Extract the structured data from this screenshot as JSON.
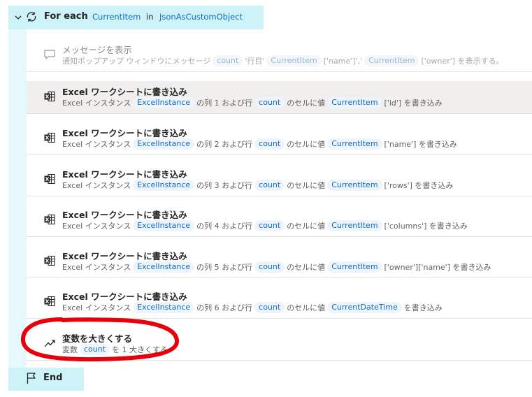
{
  "loop": {
    "label": "For each",
    "variable": "CurrentItem",
    "in_text": "in",
    "list": "JsonAsCustomObject",
    "end_label": "End"
  },
  "actions": [
    {
      "title": "メッセージを表示",
      "icon": "message-icon",
      "disabled": true,
      "desc": [
        {
          "t": "text",
          "v": "通知ポップアップ ウィンドウにメッセージ"
        },
        {
          "t": "var",
          "v": "count"
        },
        {
          "t": "text",
          "v": "'行目'"
        },
        {
          "t": "var",
          "v": "CurrentItem"
        },
        {
          "t": "text",
          "v": "['name']','"
        },
        {
          "t": "var",
          "v": "CurrentItem"
        },
        {
          "t": "text",
          "v": "['owner'] を表示する。"
        }
      ]
    },
    {
      "title": "Excel ワークシートに書き込み",
      "icon": "excel-icon",
      "selected": true,
      "desc": [
        {
          "t": "text",
          "v": "Excel インスタンス"
        },
        {
          "t": "var",
          "v": "ExcelInstance"
        },
        {
          "t": "text",
          "v": "の列 1 および行"
        },
        {
          "t": "var",
          "v": "count"
        },
        {
          "t": "text",
          "v": "のセルに値"
        },
        {
          "t": "var",
          "v": "CurrentItem"
        },
        {
          "t": "text",
          "v": "['id'] を書き込み"
        }
      ]
    },
    {
      "title": "Excel ワークシートに書き込み",
      "icon": "excel-icon",
      "desc": [
        {
          "t": "text",
          "v": "Excel インスタンス"
        },
        {
          "t": "var",
          "v": "ExcelInstance"
        },
        {
          "t": "text",
          "v": "の列 2 および行"
        },
        {
          "t": "var",
          "v": "count"
        },
        {
          "t": "text",
          "v": "のセルに値"
        },
        {
          "t": "var",
          "v": "CurrentItem"
        },
        {
          "t": "text",
          "v": "['name'] を書き込み"
        }
      ]
    },
    {
      "title": "Excel ワークシートに書き込み",
      "icon": "excel-icon",
      "desc": [
        {
          "t": "text",
          "v": "Excel インスタンス"
        },
        {
          "t": "var",
          "v": "ExcelInstance"
        },
        {
          "t": "text",
          "v": "の列 3 および行"
        },
        {
          "t": "var",
          "v": "count"
        },
        {
          "t": "text",
          "v": "のセルに値"
        },
        {
          "t": "var",
          "v": "CurrentItem"
        },
        {
          "t": "text",
          "v": "['rows'] を書き込み"
        }
      ]
    },
    {
      "title": "Excel ワークシートに書き込み",
      "icon": "excel-icon",
      "desc": [
        {
          "t": "text",
          "v": "Excel インスタンス"
        },
        {
          "t": "var",
          "v": "ExcelInstance"
        },
        {
          "t": "text",
          "v": "の列 4 および行"
        },
        {
          "t": "var",
          "v": "count"
        },
        {
          "t": "text",
          "v": "のセルに値"
        },
        {
          "t": "var",
          "v": "CurrentItem"
        },
        {
          "t": "text",
          "v": "['columns'] を書き込み"
        }
      ]
    },
    {
      "title": "Excel ワークシートに書き込み",
      "icon": "excel-icon",
      "desc": [
        {
          "t": "text",
          "v": "Excel インスタンス"
        },
        {
          "t": "var",
          "v": "ExcelInstance"
        },
        {
          "t": "text",
          "v": "の列 5 および行"
        },
        {
          "t": "var",
          "v": "count"
        },
        {
          "t": "text",
          "v": "のセルに値"
        },
        {
          "t": "var",
          "v": "CurrentItem"
        },
        {
          "t": "text",
          "v": "['owner']['name'] を書き込み"
        }
      ]
    },
    {
      "title": "Excel ワークシートに書き込み",
      "icon": "excel-icon",
      "desc": [
        {
          "t": "text",
          "v": "Excel インスタンス"
        },
        {
          "t": "var",
          "v": "ExcelInstance"
        },
        {
          "t": "text",
          "v": "の列 6 および行"
        },
        {
          "t": "var",
          "v": "count"
        },
        {
          "t": "text",
          "v": "のセルに値"
        },
        {
          "t": "var",
          "v": "CurrentDateTime"
        },
        {
          "t": "text",
          "v": "を書き込み"
        }
      ]
    },
    {
      "title": "変数を大きくする",
      "icon": "trend-up-icon",
      "annotated": true,
      "desc": [
        {
          "t": "text",
          "v": "変数"
        },
        {
          "t": "var",
          "v": "count"
        },
        {
          "t": "text",
          "v": "を 1 大きくする"
        }
      ]
    }
  ],
  "colors": {
    "loop_header_bg": "#cdf3f8",
    "loop_bar_bg": "#e6f8fb",
    "variable_text": "#0f6cbd",
    "token_bg": "#eef4fb",
    "selected_card_bg": "#f1efee",
    "annotation_red": "#e8000b"
  }
}
